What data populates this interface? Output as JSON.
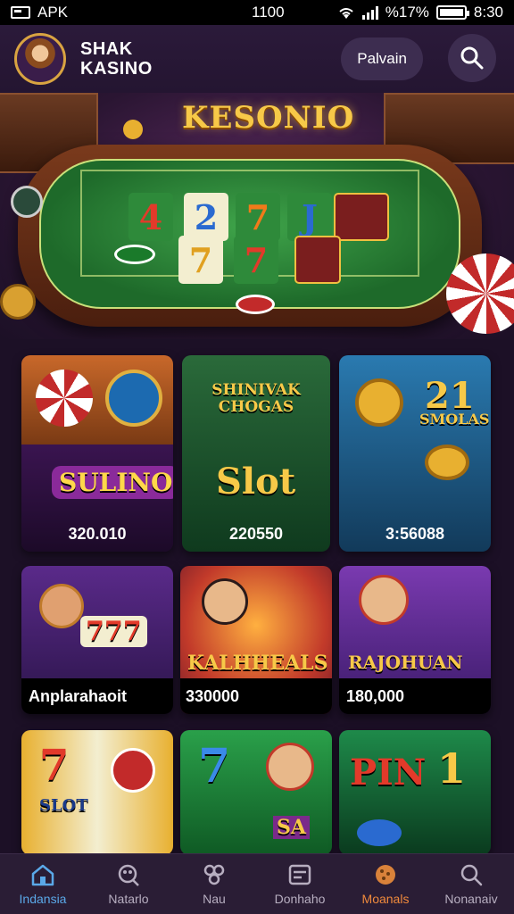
{
  "status_bar": {
    "app_label": "APK",
    "center_text": "1100",
    "battery_text": "%17%",
    "time": "8:30"
  },
  "header": {
    "brand_line1": "SHAK",
    "brand_line2": "KASINO",
    "action_button": "Palvain",
    "search_icon": "search-icon"
  },
  "hero": {
    "title": "KESONIO",
    "cards": [
      "4",
      "2",
      "7",
      "J",
      "7",
      "7"
    ]
  },
  "games": [
    {
      "logo": "SULINO",
      "value": "320.010",
      "bg": "#6a2a70"
    },
    {
      "logo": "Slot",
      "subtitle": "SHINIVAK CHOGAS",
      "value": "220550",
      "bg": "#1e4a2a"
    },
    {
      "logo": "21",
      "subtitle": "SMOLAS",
      "value": "3:56088",
      "bg": "#1c4a70"
    },
    {
      "logo": "777",
      "value": "Anplarahaoit",
      "bg": "#3a2060"
    },
    {
      "logo": "KALHHEALS",
      "value": "330000",
      "bg": "#8a2a40"
    },
    {
      "logo": "RAJOHUAN",
      "value": "180,000",
      "bg": "#5a2a88"
    },
    {
      "logo": "7",
      "subtitle": "SLOT",
      "bg": "#a02020"
    },
    {
      "logo": "7",
      "subtitle": "SA",
      "bg": "#1a7a3a"
    },
    {
      "logo": "PIN",
      "subtitle": "1",
      "bg": "#1a6a3a"
    }
  ],
  "bottom_nav": [
    {
      "label": "Indansia",
      "icon": "home-icon"
    },
    {
      "label": "Natarlo",
      "icon": "casino-icon"
    },
    {
      "label": "Nau",
      "icon": "cards-icon"
    },
    {
      "label": "Donhaho",
      "icon": "dashboard-icon"
    },
    {
      "label": "Moanals",
      "icon": "cookie-icon"
    },
    {
      "label": "Nonanaiv",
      "icon": "search-icon"
    }
  ],
  "colors": {
    "accent_gold": "#f7c948",
    "nav_active": "#5aa8e8",
    "nav_highlight": "#f08a3c",
    "background": "#1c1026"
  }
}
